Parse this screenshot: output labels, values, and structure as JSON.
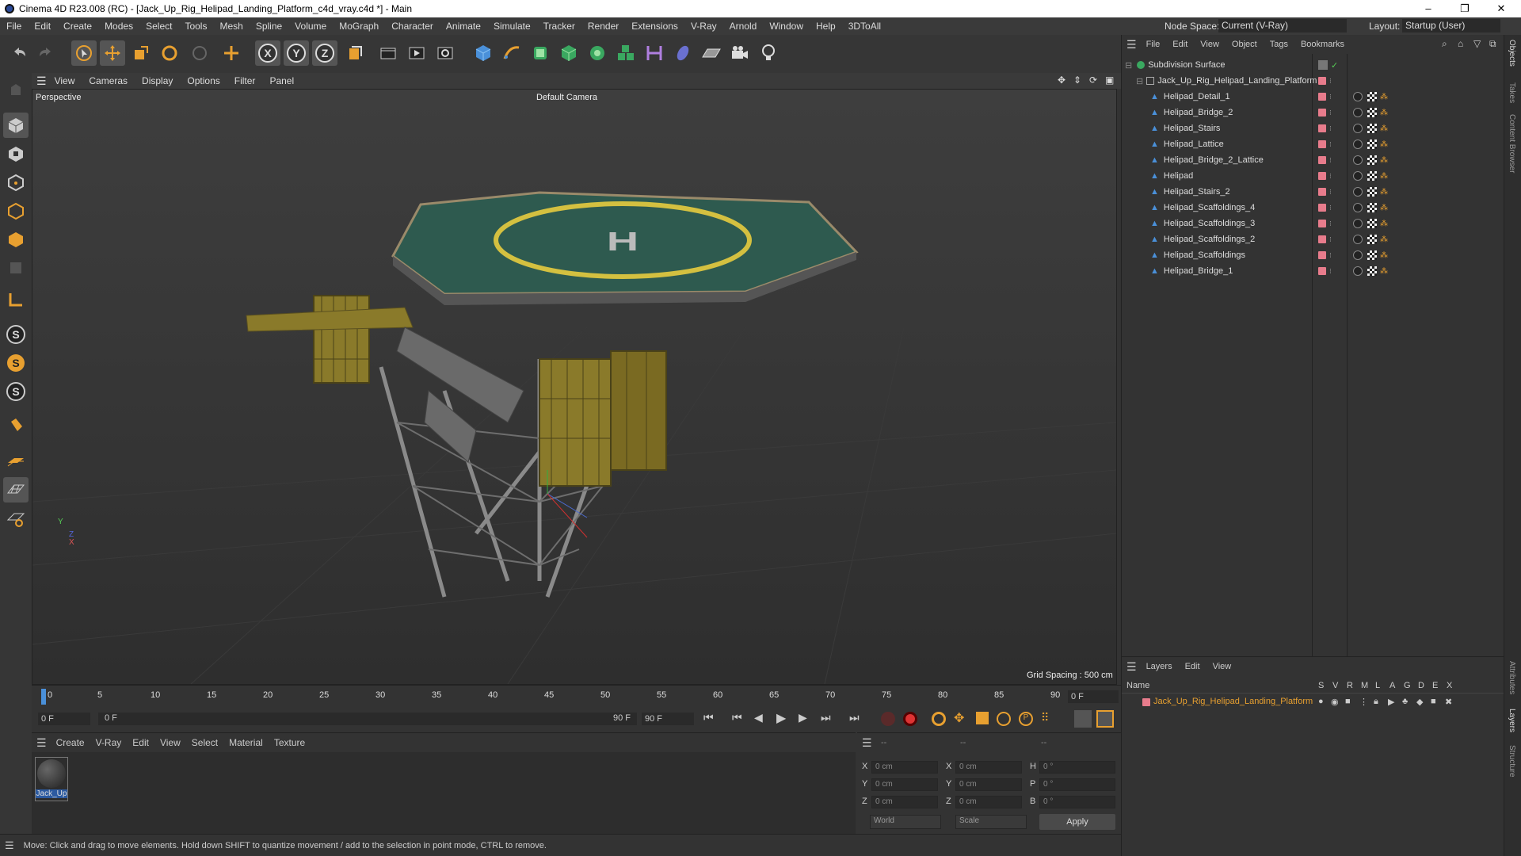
{
  "titlebar": {
    "title": "Cinema 4D R23.008 (RC) - [Jack_Up_Rig_Helipad_Landing_Platform_c4d_vray.c4d *] - Main",
    "minimize": "–",
    "maximize": "❐",
    "close": "✕"
  },
  "menubar": {
    "items": [
      "File",
      "Edit",
      "Create",
      "Modes",
      "Select",
      "Tools",
      "Mesh",
      "Spline",
      "Volume",
      "MoGraph",
      "Character",
      "Animate",
      "Simulate",
      "Tracker",
      "Render",
      "Extensions",
      "V-Ray",
      "Arnold",
      "Window",
      "Help",
      "3DToAll"
    ],
    "node_space_label": "Node Space:",
    "node_space_value": "Current (V-Ray)",
    "layout_label": "Layout:",
    "layout_value": "Startup (User)"
  },
  "viewport": {
    "menu": [
      "View",
      "Cameras",
      "Display",
      "Options",
      "Filter",
      "Panel"
    ],
    "mode": "Perspective",
    "camera": "Default Camera",
    "grid_spacing": "Grid Spacing : 500 cm",
    "axis_y": "Y",
    "axis_z": "Z",
    "axis_x": "X"
  },
  "timeline": {
    "ticks": [
      "0",
      "5",
      "10",
      "15",
      "20",
      "25",
      "30",
      "35",
      "40",
      "45",
      "50",
      "55",
      "60",
      "65",
      "70",
      "75",
      "80",
      "85",
      "90"
    ],
    "current_frame": "0 F",
    "range_start": "0 F",
    "range_start_inner": "0 F",
    "range_end_inner": "90 F",
    "range_end": "90 F"
  },
  "material_manager": {
    "menu": [
      "Create",
      "V-Ray",
      "Edit",
      "View",
      "Select",
      "Material",
      "Texture"
    ],
    "material_name": "Jack_Up"
  },
  "attributes": {
    "header_dashes": [
      "--",
      "--",
      "--"
    ],
    "rows": [
      {
        "a": "X",
        "av": "0 cm",
        "b": "X",
        "bv": "0 cm",
        "c": "H",
        "cv": "0 °"
      },
      {
        "a": "Y",
        "av": "0 cm",
        "b": "Y",
        "bv": "0 cm",
        "c": "P",
        "cv": "0 °"
      },
      {
        "a": "Z",
        "av": "0 cm",
        "b": "Z",
        "bv": "0 cm",
        "c": "B",
        "cv": "0 °"
      }
    ],
    "coord_mode": "World",
    "transform_mode": "Scale",
    "apply_label": "Apply"
  },
  "status": {
    "text": "Move: Click and drag to move elements. Hold down SHIFT to quantize movement / add to the selection in point mode, CTRL to remove."
  },
  "object_manager": {
    "menu": [
      "File",
      "Edit",
      "View",
      "Object",
      "Tags",
      "Bookmarks"
    ],
    "root": "Subdivision Surface",
    "group": "Jack_Up_Rig_Helipad_Landing_Platform",
    "children": [
      "Helipad_Detail_1",
      "Helipad_Bridge_2",
      "Helipad_Stairs",
      "Helipad_Lattice",
      "Helipad_Bridge_2_Lattice",
      "Helipad",
      "Helipad_Stairs_2",
      "Helipad_Scaffoldings_4",
      "Helipad_Scaffoldings_3",
      "Helipad_Scaffoldings_2",
      "Helipad_Scaffoldings",
      "Helipad_Bridge_1"
    ]
  },
  "layer_manager": {
    "menu": [
      "Layers",
      "Edit",
      "View"
    ],
    "col_name": "Name",
    "col_flags": [
      "S",
      "V",
      "R",
      "M",
      "L",
      "A",
      "G",
      "D",
      "E",
      "X"
    ],
    "layer_name": "Jack_Up_Rig_Helipad_Landing_Platform",
    "layer_color": "#e87c8c"
  },
  "right_tabs": [
    "Objects",
    "Takes",
    "Content Browser",
    "Attributes",
    "Layers",
    "Structure"
  ],
  "colors": {
    "accent_orange": "#e8a030",
    "pink_tag": "#e87c8c",
    "record_red": "#d33",
    "helipad_green": "#2e5a4f"
  }
}
